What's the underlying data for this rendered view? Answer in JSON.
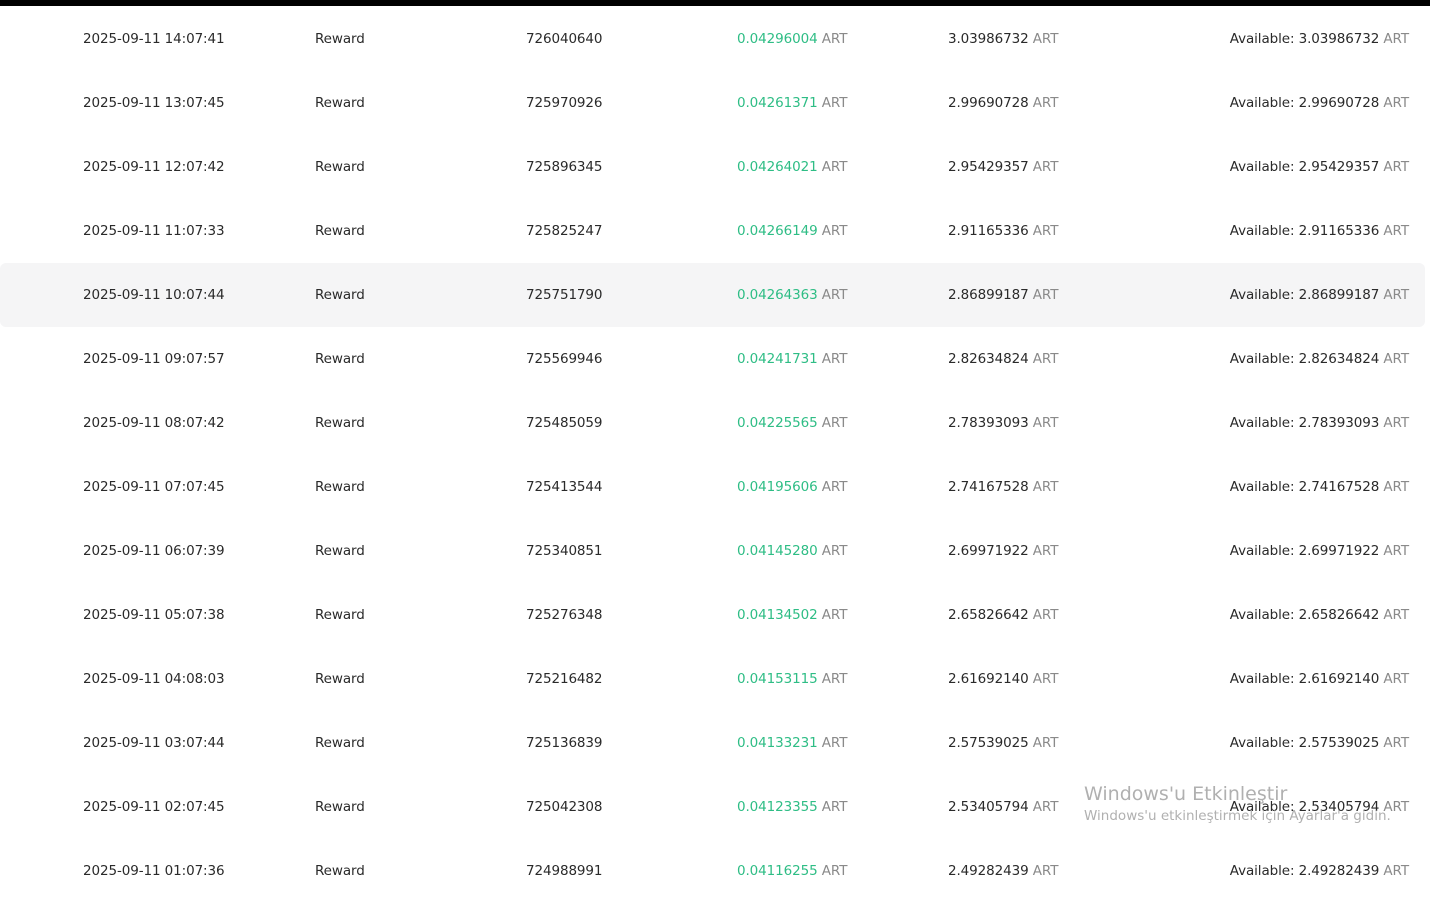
{
  "unit": "ART",
  "available_prefix": "Available:",
  "accent_green": "#2ebd85",
  "rows": [
    {
      "time": "2025-09-11 14:07:41",
      "type": "Reward",
      "id": "726040640",
      "amount": "0.04296004",
      "balance": "3.03986732",
      "available": "3.03986732"
    },
    {
      "time": "2025-09-11 13:07:45",
      "type": "Reward",
      "id": "725970926",
      "amount": "0.04261371",
      "balance": "2.99690728",
      "available": "2.99690728"
    },
    {
      "time": "2025-09-11 12:07:42",
      "type": "Reward",
      "id": "725896345",
      "amount": "0.04264021",
      "balance": "2.95429357",
      "available": "2.95429357"
    },
    {
      "time": "2025-09-11 11:07:33",
      "type": "Reward",
      "id": "725825247",
      "amount": "0.04266149",
      "balance": "2.91165336",
      "available": "2.91165336"
    },
    {
      "time": "2025-09-11 10:07:44",
      "type": "Reward",
      "id": "725751790",
      "amount": "0.04264363",
      "balance": "2.86899187",
      "available": "2.86899187"
    },
    {
      "time": "2025-09-11 09:07:57",
      "type": "Reward",
      "id": "725569946",
      "amount": "0.04241731",
      "balance": "2.82634824",
      "available": "2.82634824"
    },
    {
      "time": "2025-09-11 08:07:42",
      "type": "Reward",
      "id": "725485059",
      "amount": "0.04225565",
      "balance": "2.78393093",
      "available": "2.78393093"
    },
    {
      "time": "2025-09-11 07:07:45",
      "type": "Reward",
      "id": "725413544",
      "amount": "0.04195606",
      "balance": "2.74167528",
      "available": "2.74167528"
    },
    {
      "time": "2025-09-11 06:07:39",
      "type": "Reward",
      "id": "725340851",
      "amount": "0.04145280",
      "balance": "2.69971922",
      "available": "2.69971922"
    },
    {
      "time": "2025-09-11 05:07:38",
      "type": "Reward",
      "id": "725276348",
      "amount": "0.04134502",
      "balance": "2.65826642",
      "available": "2.65826642"
    },
    {
      "time": "2025-09-11 04:08:03",
      "type": "Reward",
      "id": "725216482",
      "amount": "0.04153115",
      "balance": "2.61692140",
      "available": "2.61692140"
    },
    {
      "time": "2025-09-11 03:07:44",
      "type": "Reward",
      "id": "725136839",
      "amount": "0.04133231",
      "balance": "2.57539025",
      "available": "2.57539025"
    },
    {
      "time": "2025-09-11 02:07:45",
      "type": "Reward",
      "id": "725042308",
      "amount": "0.04123355",
      "balance": "2.53405794",
      "available": "2.53405794"
    },
    {
      "time": "2025-09-11 01:07:36",
      "type": "Reward",
      "id": "724988991",
      "amount": "0.04116255",
      "balance": "2.49282439",
      "available": "2.49282439"
    }
  ],
  "watermark": {
    "title": "Windows'u Etkinleştir",
    "subtitle": "Windows'u etkinleştirmek için Ayarlar'a gidin."
  }
}
